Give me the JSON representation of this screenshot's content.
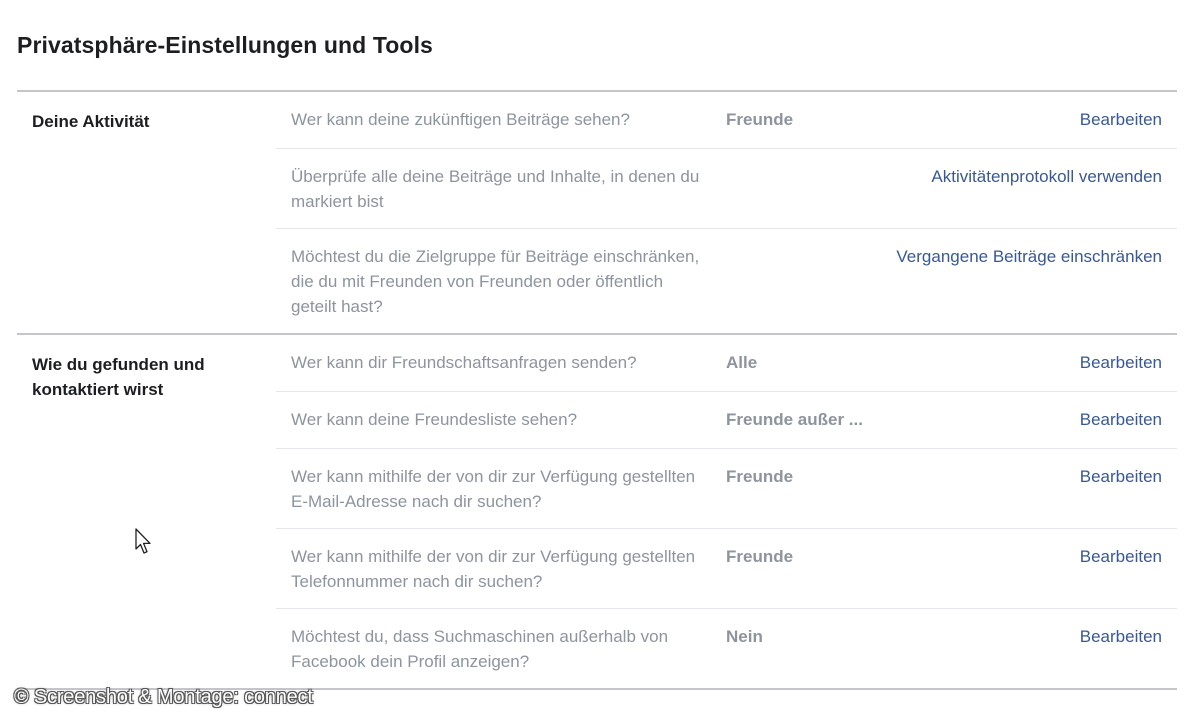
{
  "page": {
    "title": "Privatsphäre-Einstellungen und Tools"
  },
  "sections": [
    {
      "title": "Deine Aktivität",
      "rows": [
        {
          "question": "Wer kann deine zukünftigen Beiträge sehen?",
          "value": "Freunde",
          "action": "Bearbeiten"
        },
        {
          "question": "Überprüfe alle deine Beiträge und Inhalte, in denen du markiert bist",
          "value": "",
          "action": "Aktivitätenprotokoll verwenden"
        },
        {
          "question": "Möchtest du die Zielgruppe für Beiträge einschränken, die du mit Freunden von Freunden oder öffentlich geteilt hast?",
          "value": "",
          "action": "Vergangene Beiträge einschränken"
        }
      ]
    },
    {
      "title": "Wie du gefunden und kontaktiert wirst",
      "rows": [
        {
          "question": "Wer kann dir Freundschaftsanfragen senden?",
          "value": "Alle",
          "action": "Bearbeiten"
        },
        {
          "question": "Wer kann deine Freundesliste sehen?",
          "value": "Freunde außer ...",
          "action": "Bearbeiten"
        },
        {
          "question": "Wer kann mithilfe der von dir zur Verfügung gestellten E-Mail-Adresse nach dir suchen?",
          "value": "Freunde",
          "action": "Bearbeiten"
        },
        {
          "question": "Wer kann mithilfe der von dir zur Verfügung gestellten Telefonnummer nach dir suchen?",
          "value": "Freunde",
          "action": "Bearbeiten"
        },
        {
          "question": "Möchtest du, dass Suchmaschinen außerhalb von Facebook dein Profil anzeigen?",
          "value": "Nein",
          "action": "Bearbeiten"
        }
      ]
    }
  ],
  "watermark": "© Screenshot & Montage: connect",
  "icons": {
    "cursor": "mouse-pointer-icon"
  },
  "colors": {
    "link": "#385898",
    "muted_text": "#8d949e",
    "heading": "#1c1e21",
    "divider": "#c4c6ca"
  }
}
